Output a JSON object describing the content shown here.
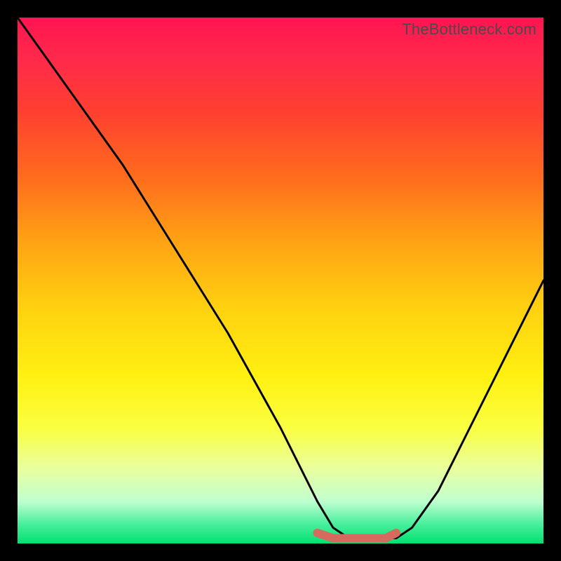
{
  "watermark": "TheBottleneck.com",
  "chart_data": {
    "type": "line",
    "title": "",
    "xlabel": "",
    "ylabel": "",
    "xlim": [
      0,
      100
    ],
    "ylim": [
      0,
      100
    ],
    "series": [
      {
        "name": "bottleneck-curve",
        "x": [
          0,
          5,
          10,
          15,
          20,
          25,
          30,
          35,
          40,
          45,
          50,
          55,
          57,
          60,
          63,
          66,
          70,
          72,
          75,
          80,
          85,
          90,
          95,
          100
        ],
        "values": [
          100,
          93,
          86,
          79,
          72,
          64,
          56,
          48,
          40,
          31,
          22,
          12,
          8,
          3,
          1,
          1,
          1,
          1,
          3,
          10,
          20,
          30,
          40,
          50
        ]
      },
      {
        "name": "optimal-zone",
        "x": [
          57,
          60,
          63,
          66,
          70,
          72
        ],
        "values": [
          2,
          1,
          1,
          1,
          1,
          2
        ]
      }
    ],
    "optimal_zone_color": "#d76a5f",
    "curve_color": "#000000"
  }
}
